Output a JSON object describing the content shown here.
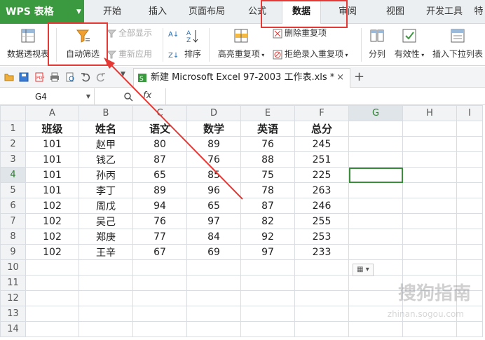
{
  "menu": {
    "logo": "WPS 表格",
    "tabs": [
      "开始",
      "插入",
      "页面布局",
      "公式",
      "数据",
      "审阅",
      "视图",
      "开发工具",
      "特"
    ],
    "active_tab": "数据"
  },
  "ribbon": {
    "pivot": "数据透视表",
    "autofilter": "自动筛选",
    "show_all": "全部显示",
    "reapply": "重新应用",
    "sort": "排序",
    "highlight_dup": "高亮重复项",
    "remove_dup": "删除重复项",
    "reject_dup": "拒绝录入重复项",
    "split": "分列",
    "validity": "有效性",
    "dropdown_list": "插入下拉列表"
  },
  "file_tab": {
    "title": "新建 Microsoft Excel 97-2003 工作表.xls *",
    "close": "×",
    "add": "+"
  },
  "formula_bar": {
    "cell_ref": "G4",
    "fx": "fx"
  },
  "sheet": {
    "columns": [
      "A",
      "B",
      "C",
      "D",
      "E",
      "F",
      "G",
      "H",
      "I"
    ],
    "rows": [
      "1",
      "2",
      "3",
      "4",
      "5",
      "6",
      "7",
      "8",
      "9",
      "10",
      "11",
      "12",
      "13",
      "14"
    ],
    "headers": [
      "班级",
      "姓名",
      "语文",
      "数学",
      "英语",
      "总分"
    ],
    "data": [
      [
        "101",
        "赵甲",
        "80",
        "89",
        "76",
        "245"
      ],
      [
        "101",
        "钱乙",
        "87",
        "76",
        "88",
        "251"
      ],
      [
        "101",
        "孙丙",
        "65",
        "85",
        "75",
        "225"
      ],
      [
        "101",
        "李丁",
        "89",
        "96",
        "78",
        "263"
      ],
      [
        "102",
        "周戊",
        "94",
        "65",
        "87",
        "246"
      ],
      [
        "102",
        "吴己",
        "76",
        "97",
        "82",
        "255"
      ],
      [
        "102",
        "郑庚",
        "77",
        "84",
        "92",
        "253"
      ],
      [
        "102",
        "王辛",
        "67",
        "69",
        "97",
        "233"
      ]
    ]
  },
  "watermark": {
    "text": "搜狗指南",
    "url": "zhinan.sogou.com"
  },
  "colors": {
    "accent_green": "#3b9a3f",
    "annotation_red": "#e53935"
  }
}
